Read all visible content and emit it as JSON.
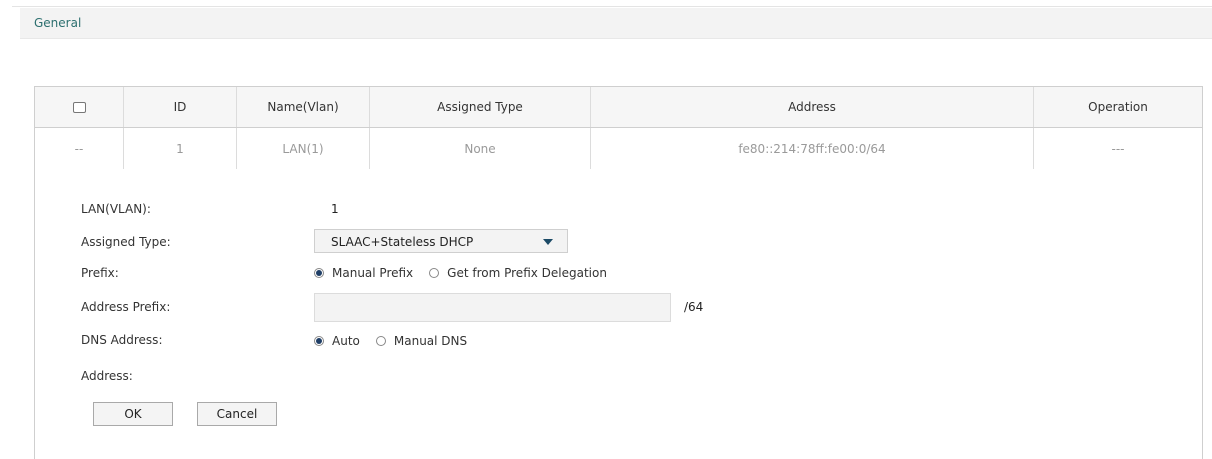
{
  "section": {
    "title": "General"
  },
  "table": {
    "headers": [
      "",
      "ID",
      "Name(Vlan)",
      "Assigned Type",
      "Address",
      "Operation"
    ],
    "row": {
      "select": "--",
      "id": "1",
      "name": "LAN(1)",
      "assigned_type": "None",
      "address": "fe80::214:78ff:fe00:0/64",
      "operation": "---"
    }
  },
  "form": {
    "lan_label": "LAN(VLAN):",
    "lan_value": "1",
    "assigned_type_label": "Assigned Type:",
    "assigned_type_value": "SLAAC+Stateless DHCP",
    "prefix_label": "Prefix:",
    "prefix_options": [
      "Manual Prefix",
      "Get from Prefix Delegation"
    ],
    "prefix_selected": "Manual Prefix",
    "address_prefix_label": "Address Prefix:",
    "address_prefix_value": "",
    "address_prefix_suffix": "/64",
    "dns_label": "DNS Address:",
    "dns_options": [
      "Auto",
      "Manual DNS"
    ],
    "dns_selected": "Auto",
    "address_label": "Address:",
    "ok_label": "OK",
    "cancel_label": "Cancel"
  },
  "colors": {
    "header_bg": "#f6f6f6",
    "radio_on": "#1f3e66",
    "section_text": "#2c6f6f"
  }
}
